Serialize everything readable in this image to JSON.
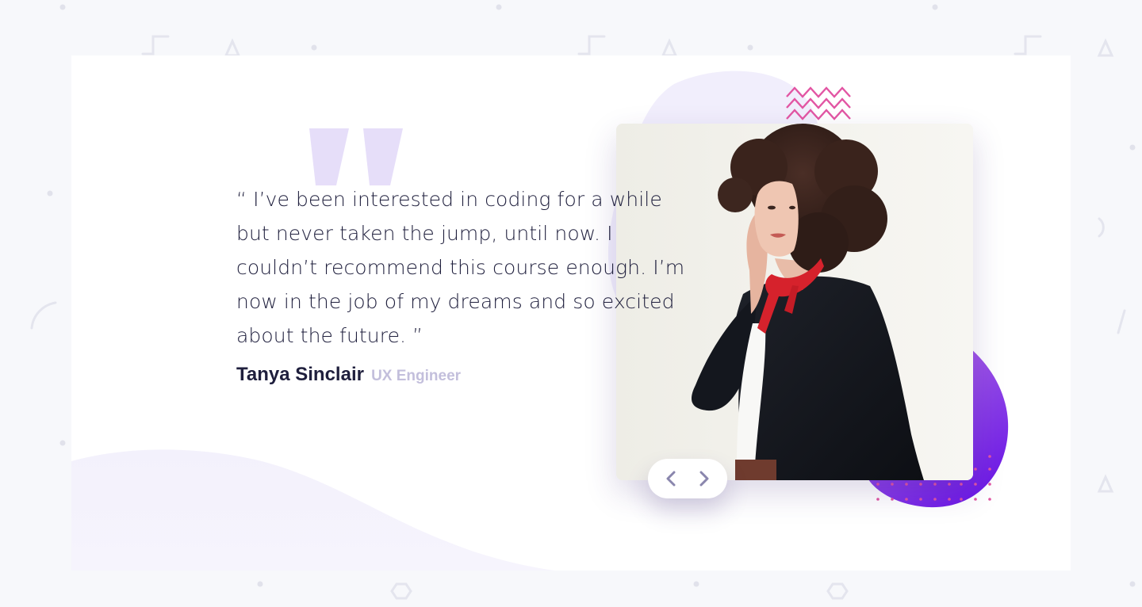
{
  "testimonial": {
    "quote": "“ I’ve been interested in coding for a while but never taken the jump, until now. I couldn’t recommend this course enough. I’m now in the job of my dreams and so excited about the future. ”",
    "author_name": "Tanya Sinclair",
    "author_role": "UX Engineer"
  },
  "photo": {
    "subject": "portrait of Tanya Sinclair",
    "icon": "profile-photo"
  },
  "navigation": {
    "previous_icon": "chevron-left-icon",
    "next_icon": "chevron-right-icon"
  },
  "colors": {
    "text_dark": "#1f1f3d",
    "text_muted": "#c3bfdc",
    "accent_purple": "#6e2fe8",
    "accent_pink": "#e255a3",
    "soft_lavender": "#f0edfb",
    "page_background": "#f7f8fb",
    "card_background": "#ffffff"
  }
}
